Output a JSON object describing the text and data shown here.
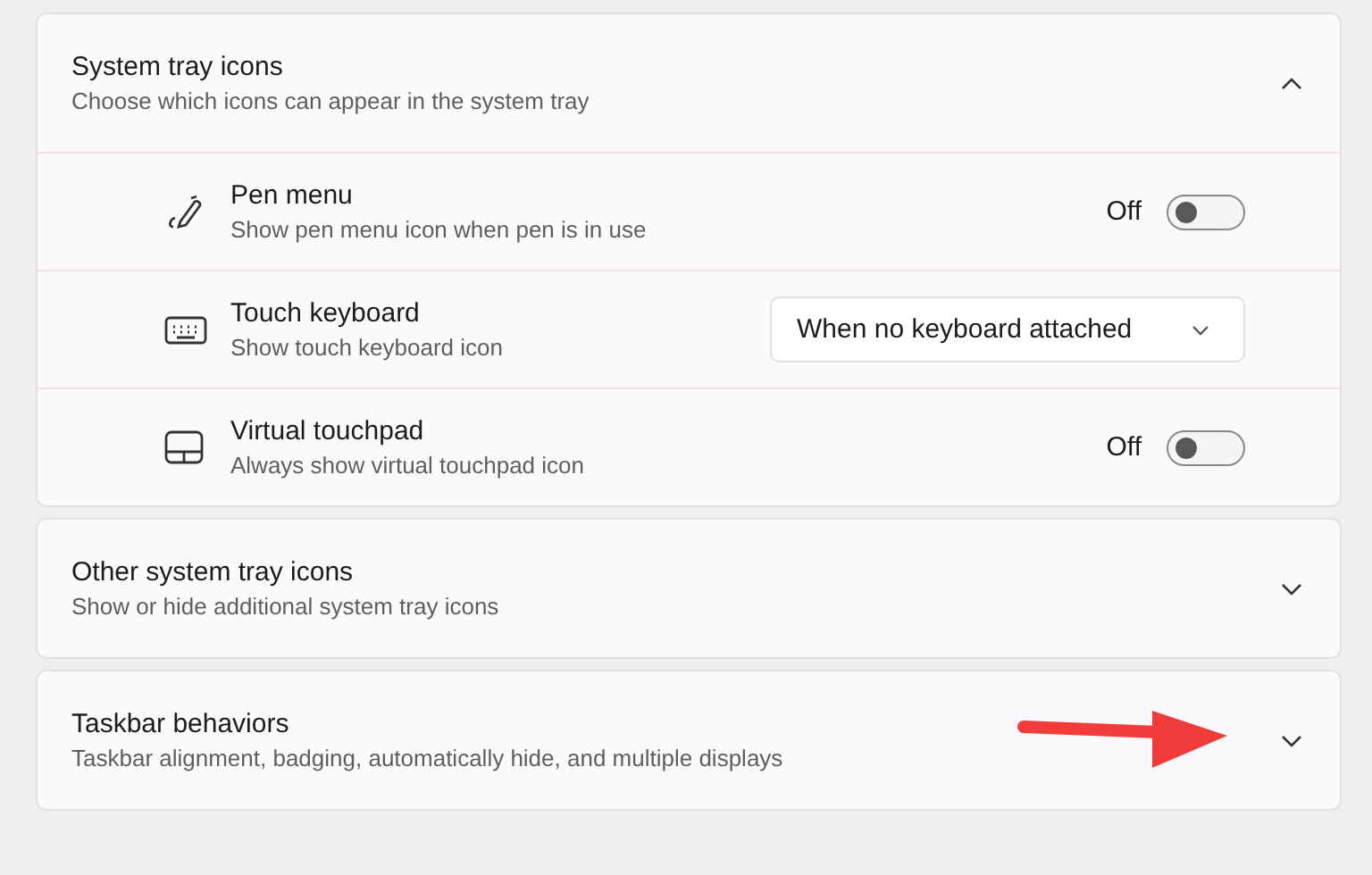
{
  "sections": [
    {
      "title": "System tray icons",
      "subtitle": "Choose which icons can appear in the system tray",
      "expanded": true,
      "items": [
        {
          "kind": "toggle",
          "title": "Pen menu",
          "subtitle": "Show pen menu icon when pen is in use",
          "state_label": "Off",
          "on": false
        },
        {
          "kind": "dropdown",
          "title": "Touch keyboard",
          "subtitle": "Show touch keyboard icon",
          "value": "When no keyboard attached"
        },
        {
          "kind": "toggle",
          "title": "Virtual touchpad",
          "subtitle": "Always show virtual touchpad icon",
          "state_label": "Off",
          "on": false
        }
      ]
    },
    {
      "title": "Other system tray icons",
      "subtitle": "Show or hide additional system tray icons",
      "expanded": false
    },
    {
      "title": "Taskbar behaviors",
      "subtitle": "Taskbar alignment, badging, automatically hide, and multiple displays",
      "expanded": false,
      "annotation": {
        "kind": "arrow"
      }
    }
  ]
}
